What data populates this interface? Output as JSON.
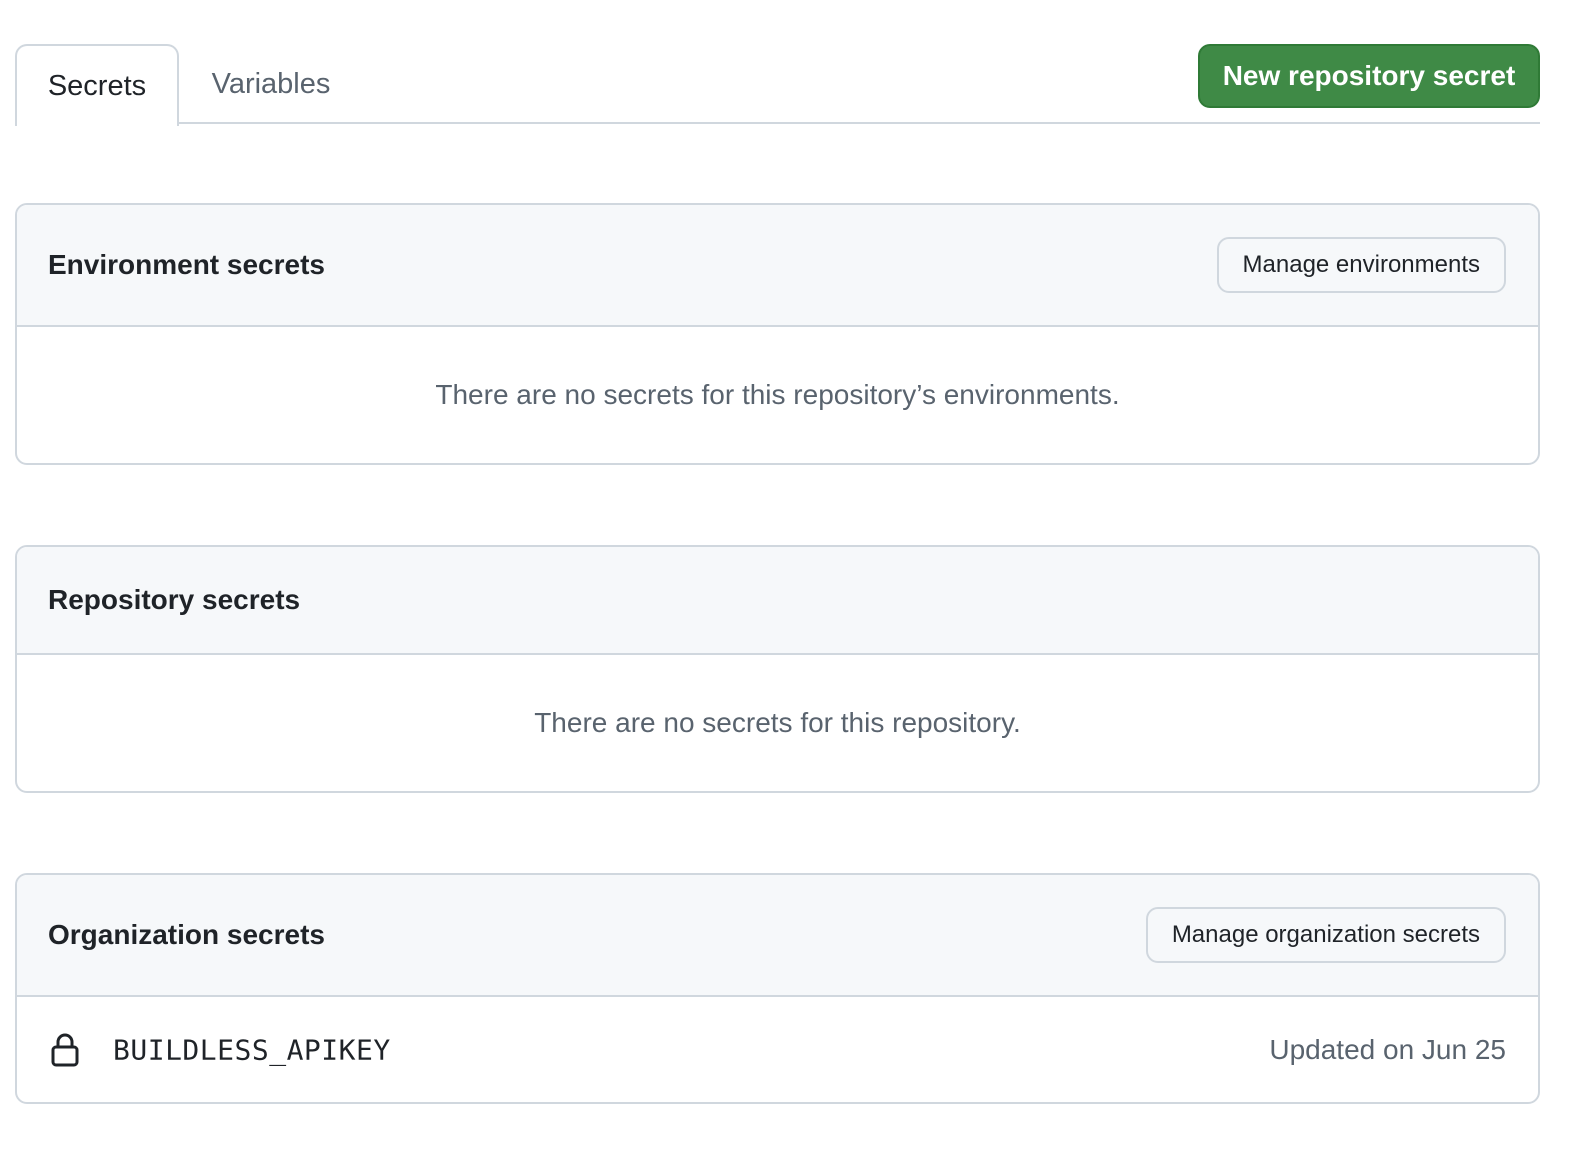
{
  "tabs": [
    {
      "label": "Secrets",
      "selected": true
    },
    {
      "label": "Variables",
      "selected": false
    }
  ],
  "new_secret_button": "New repository secret",
  "environment_secrets": {
    "title": "Environment secrets",
    "manage_button": "Manage environments",
    "empty_message": "There are no secrets for this repository’s environments."
  },
  "repository_secrets": {
    "title": "Repository secrets",
    "empty_message": "There are no secrets for this repository."
  },
  "organization_secrets": {
    "title": "Organization secrets",
    "manage_button": "Manage organization secrets",
    "items": [
      {
        "name": "BUILDLESS_APIKEY",
        "updated": "Updated on Jun 25",
        "icon": "lock-icon"
      }
    ]
  },
  "colors": {
    "primary_button": "#3f8a46",
    "border": "#d0d7de",
    "header_bg": "#f6f8fa",
    "muted_text": "#59636e"
  }
}
